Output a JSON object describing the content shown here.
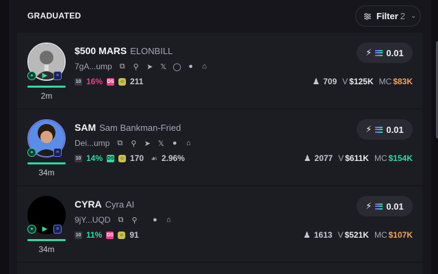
{
  "header": {
    "title": "GRADUATED",
    "filter_label": "Filter",
    "filter_count": "2"
  },
  "colors": {
    "accent_green": "#2fd9a0",
    "accent_pink": "#e8418a",
    "accent_orange": "#f0a45a"
  },
  "tokens": [
    {
      "ticker": "$500 MARS",
      "name": "ELONBILL",
      "address": "7gA...ump",
      "top10_pct": "16%",
      "dev_count": "211",
      "holders_pct": "",
      "holders": "709",
      "volume": "$125K",
      "mcap": "$83K",
      "age": "2m",
      "buy_amount": "0.01",
      "progress": 1.0,
      "socials": [
        "telegram-icon",
        "x-icon",
        "globe-icon",
        "pill-icon",
        "home-icon"
      ]
    },
    {
      "ticker": "SAM",
      "name": "Sam Bankman-Fried",
      "address": "Dei...ump",
      "top10_pct": "14%",
      "dev_count": "170",
      "holders_pct": "2.96%",
      "holders": "2077",
      "volume": "$611K",
      "mcap": "$154K",
      "age": "34m",
      "buy_amount": "0.01",
      "progress": 1.0,
      "socials": [
        "telegram-icon",
        "x-icon",
        "pill-icon",
        "home-icon"
      ]
    },
    {
      "ticker": "CYRA",
      "name": "Cyra AI",
      "address": "9jY...UQD",
      "top10_pct": "11%",
      "dev_count": "91",
      "holders_pct": "",
      "holders": "1613",
      "volume": "$521K",
      "mcap": "$107K",
      "age": "34m",
      "buy_amount": "0.01",
      "progress": 1.0,
      "socials": [
        "pill-icon",
        "home-icon"
      ]
    }
  ],
  "labels": {
    "volume_prefix": "V",
    "mcap_prefix": "MC",
    "tag_top10": "10",
    "tag_ds": "DS"
  }
}
